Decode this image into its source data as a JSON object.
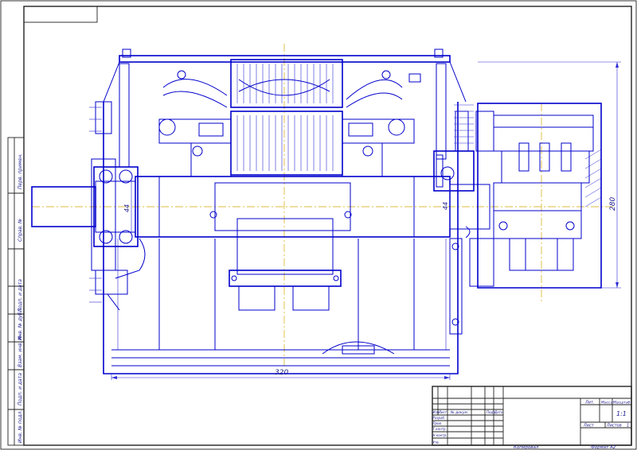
{
  "dimensions": {
    "length": "320",
    "height": "280",
    "shaft_left": "44",
    "shaft_right": "44"
  },
  "title_block": {
    "header_cols": [
      "Изм.",
      "Лист",
      "№ докум.",
      "Подп.",
      "Дата"
    ],
    "roles": [
      "Разраб.",
      "Пров.",
      "Т.контр.",
      "Н.контр.",
      "Утв."
    ],
    "lit_label": "Лит.",
    "mass_label": "Масса",
    "scale_label": "Масштаб",
    "scale_value": "1:1",
    "sheet_label": "Лист",
    "sheets_label": "Листов",
    "sheets_value": "1"
  },
  "footer": {
    "copied": "Копировал",
    "format": "Формат  А2"
  },
  "side_stamp": [
    "Перв. примен.",
    "Справ. №",
    "Подп. и дата",
    "Инв. № дубл.",
    "Взам. инв. №",
    "Подп. и дата",
    "Инв. № подл."
  ]
}
